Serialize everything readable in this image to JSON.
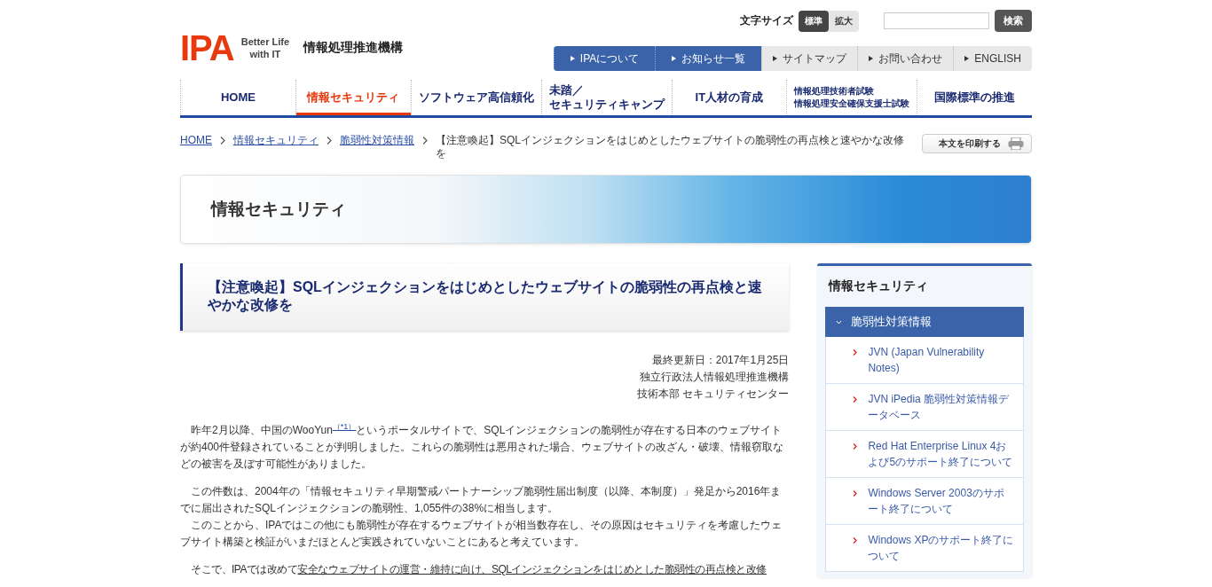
{
  "header": {
    "logo": "IPA",
    "tagline": [
      "Better Life",
      "with IT"
    ],
    "org_name": "情報処理推進機構",
    "font_size": {
      "label": "文字サイズ",
      "options": [
        {
          "label": "標準",
          "selected": true
        },
        {
          "label": "拡大",
          "selected": false
        }
      ]
    },
    "search": {
      "button": "検索"
    },
    "utility_nav": [
      {
        "label": "IPAについて",
        "kind": "primary"
      },
      {
        "label": "お知らせ一覧",
        "kind": "primary"
      },
      {
        "label": "サイトマップ",
        "kind": "secondary"
      },
      {
        "label": "お問い合わせ",
        "kind": "secondary"
      },
      {
        "label": "ENGLISH",
        "kind": "secondary"
      }
    ]
  },
  "main_nav": [
    {
      "lines": [
        "HOME"
      ],
      "selected": false
    },
    {
      "lines": [
        "情報セキュリティ"
      ],
      "selected": true
    },
    {
      "lines": [
        "ソフトウェア高信頼化"
      ],
      "selected": false
    },
    {
      "lines": [
        "未踏／",
        "セキュリティキャンプ"
      ],
      "selected": false
    },
    {
      "lines": [
        "IT人材の育成"
      ],
      "selected": false
    },
    {
      "lines": [
        "情報処理技術者試験",
        "情報処理安全確保支援士試験"
      ],
      "selected": false,
      "kind": "small"
    },
    {
      "lines": [
        "国際標準の推進"
      ],
      "selected": false
    }
  ],
  "breadcrumb": {
    "links": [
      "HOME",
      "情報セキュリティ",
      "脆弱性対策情報"
    ],
    "current": "【注意喚起】SQLインジェクションをはじめとしたウェブサイトの脆弱性の再点検と速やかな改修を"
  },
  "print_button": "本文を印刷する",
  "banner": {
    "title": "情報セキュリティ"
  },
  "article": {
    "title": "【注意喚起】SQLインジェクションをはじめとしたウェブサイトの脆弱性の再点検と速やかな改修を",
    "meta": [
      "最終更新日：2017年1月25日",
      "独立行政法人情報処理推進機構",
      "技術本部 セキュリティセンター"
    ],
    "paragraphs": [
      {
        "kind": "lead",
        "parts": [
          {
            "kind": "text",
            "text": "昨年2月以降、中国のWooYun"
          },
          {
            "kind": "footnote",
            "text": "（*1）"
          },
          {
            "kind": "text",
            "text": "というポータルサイトで、SQLインジェクションの脆弱性が存在する日本のウェブサイトが約400件登録されていることが判明しました。これらの脆弱性は悪用された場合、ウェブサイトの改ざん・破壊、情報窃取などの被害を及ぼす可能性がありました。"
          }
        ]
      },
      {
        "kind": "lead",
        "parts": [
          {
            "kind": "text",
            "text": "この件数は、2004年の「情報セキュリティ早期警戒パートナーシップ脆弱性届出制度（以降、本制度）」発足から2016年までに届出されたSQLインジェクションの脆弱性、1,055件の38%に相当します。"
          }
        ]
      },
      {
        "kind": "follow",
        "parts": [
          {
            "kind": "text",
            "text": "このことから、IPAではこの他にも脆弱性が存在するウェブサイトが相当数存在し、その原因はセキュリティを考慮したウェブサイト構築と検証がいまだほとんど実践されていないことにあると考えています。"
          }
        ]
      },
      {
        "kind": "lead",
        "parts": [
          {
            "kind": "text",
            "text": "そこで、IPAでは改めて"
          },
          {
            "kind": "link",
            "text": "安全なウェブサイトの運営・維持に向け、SQLインジェクションをはじめとした脆弱性の再点検と改修"
          }
        ]
      }
    ]
  },
  "sidebar": {
    "title": "情報セキュリティ",
    "section": {
      "label": "脆弱性対策情報",
      "expanded": true
    },
    "items": [
      "JVN (Japan Vulnerability Notes)",
      "JVN iPedia 脆弱性対策情報データベース",
      "Red Hat Enterprise Linux 4および5のサポート終了について",
      "Windows Server 2003のサポート終了について",
      "Windows XPのサポート終了について"
    ]
  }
}
